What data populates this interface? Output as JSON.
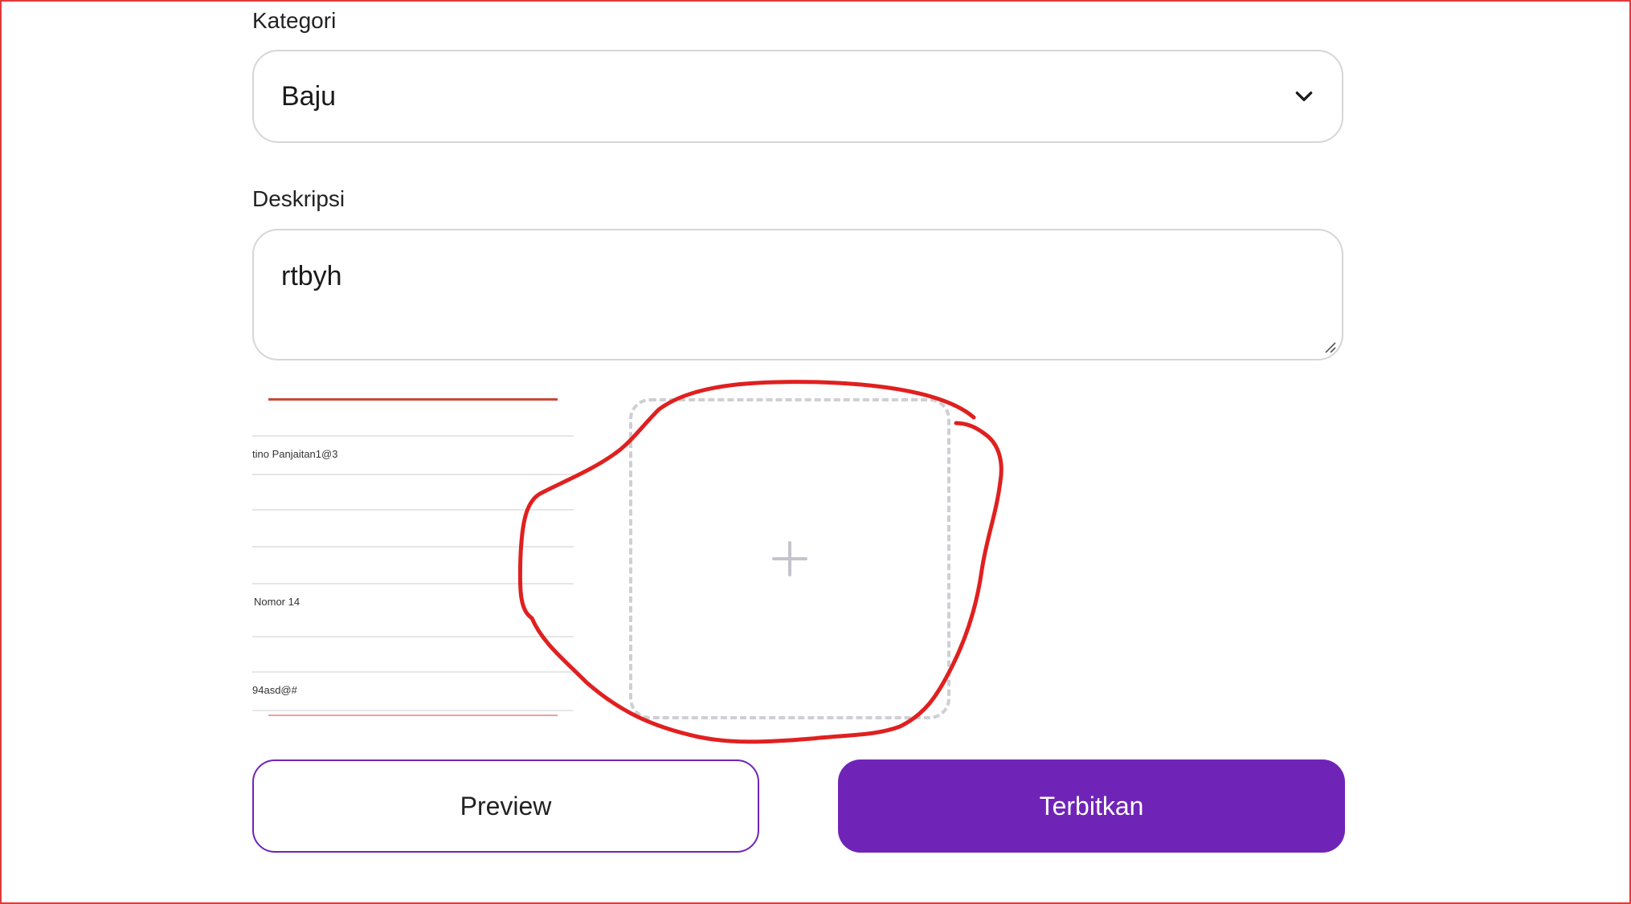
{
  "form": {
    "category_label": "Kategori",
    "category_value": "Baju",
    "description_label": "Deskripsi",
    "description_value": "rtbyh"
  },
  "thumbnail": {
    "lines": [
      "tino Panjaitan1@3",
      "Nomor 14",
      "94asd@#"
    ]
  },
  "upload": {
    "icon": "plus-icon"
  },
  "buttons": {
    "preview": "Preview",
    "publish": "Terbitkan"
  },
  "colors": {
    "accent": "#7024b7",
    "annotation": "#e02020",
    "frame": "#e23a3a"
  }
}
